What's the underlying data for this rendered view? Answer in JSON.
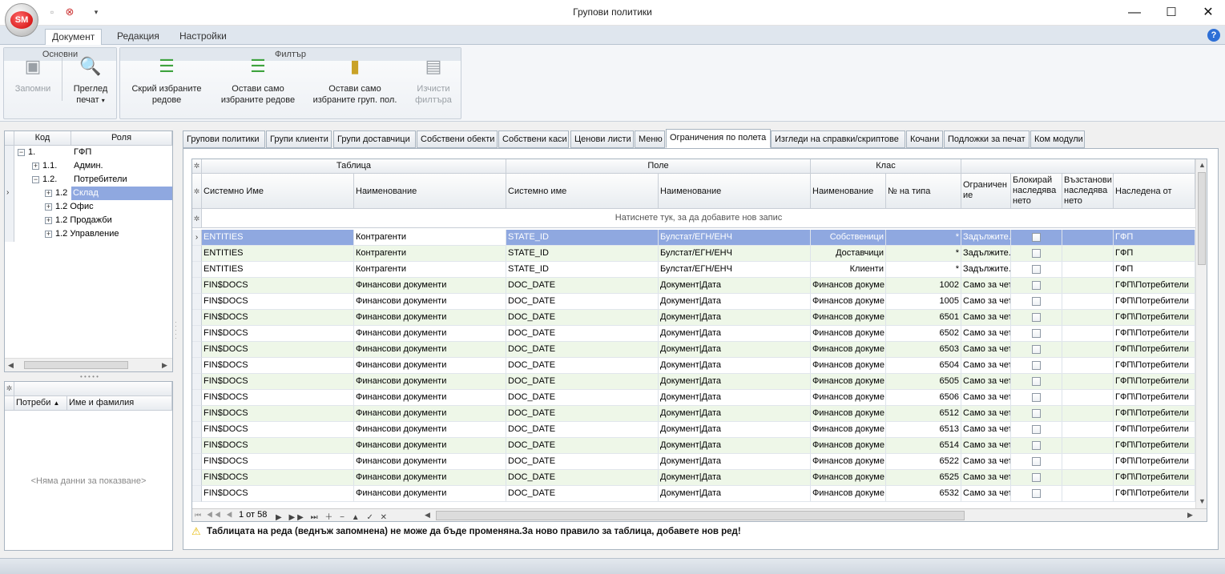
{
  "window": {
    "title": "Групови политики",
    "orb_label": "SM"
  },
  "ribbon": {
    "tabs": [
      "Документ",
      "Редакция",
      "Настройки"
    ],
    "groups": {
      "basic": {
        "label": "Основни",
        "save": "Запомни",
        "preview_l1": "Преглед",
        "preview_l2": "печат"
      },
      "filter": {
        "label": "Филтър",
        "hide_l1": "Скрий избраните",
        "hide_l2": "редове",
        "keep_l1": "Остави само",
        "keep_l2": "избраните редове",
        "keepgrp_l1": "Остави само",
        "keepgrp_l2": "избраните груп. пол.",
        "clear_l1": "Изчисти",
        "clear_l2": "филтъра"
      }
    }
  },
  "left_tree": {
    "headers": {
      "code": "Код",
      "role": "Роля"
    },
    "rows": [
      {
        "code": "1.",
        "role": "ГФП"
      },
      {
        "code": "1.1.",
        "role": "Админ."
      },
      {
        "code": "1.2.",
        "role": "Потребители"
      },
      {
        "code": "1.2",
        "role": "Склад"
      },
      {
        "code": "1.2",
        "role": "Офис"
      },
      {
        "code": "1.2",
        "role": "Продажби"
      },
      {
        "code": "1.2",
        "role": "Управление"
      }
    ]
  },
  "users_grid": {
    "headers": {
      "user": "Потреби",
      "name": "Име и фамилия"
    },
    "empty": "<Няма данни за показване>"
  },
  "tabs": [
    "Групови политики",
    "Групи клиенти",
    "Групи доставчици",
    "Собствени обекти",
    "Собствени каси",
    "Ценови листи",
    "Меню",
    "Ограничения по полета",
    "Изгледи на справки/скриптове",
    "Кочани",
    "Подложки за печат",
    "Ком модули"
  ],
  "main_grid": {
    "bands": {
      "table": "Таблица",
      "field": "Поле",
      "class": "Клас"
    },
    "columns": [
      "Системно Име",
      "Наименование",
      "Системно име",
      "Наименование",
      "Наименование",
      "№ на типа",
      "Ограничение",
      "Блокирай наследяването",
      "Възстанови наследяването",
      "Наследена от"
    ],
    "col_l1": {
      "restrict": "Ограничен",
      "block": "Блокирай",
      "restore": "Възстанови"
    },
    "col_l2": {
      "restrict": "ие",
      "block": "наследява",
      "restore": "наследява"
    },
    "col_l3": {
      "block": "нето",
      "restore": "нето"
    },
    "new_row": "Натиснете тук, за да добавите нов запис",
    "rows": [
      {
        "sys": "ENTITIES",
        "name": "Контрагенти",
        "fsys": "STATE_ID",
        "fname": "Булстат/ЕГН/ЕНЧ",
        "cls": "Собственици",
        "type": "*",
        "restr": "Задължите.",
        "inh": "ГФП"
      },
      {
        "sys": "ENTITIES",
        "name": "Контрагенти",
        "fsys": "STATE_ID",
        "fname": "Булстат/ЕГН/ЕНЧ",
        "cls": "Доставчици",
        "type": "*",
        "restr": "Задължите.",
        "inh": "ГФП"
      },
      {
        "sys": "ENTITIES",
        "name": "Контрагенти",
        "fsys": "STATE_ID",
        "fname": "Булстат/ЕГН/ЕНЧ",
        "cls": "Клиенти",
        "type": "*",
        "restr": "Задължите.",
        "inh": "ГФП"
      },
      {
        "sys": "FIN$DOCS",
        "name": "Финансови документи",
        "fsys": "DOC_DATE",
        "fname": "Документ|Дата",
        "cls": "Финансов докуме",
        "type": "1002",
        "restr": "Само за чет",
        "inh": "ГФП\\Потребители"
      },
      {
        "sys": "FIN$DOCS",
        "name": "Финансови документи",
        "fsys": "DOC_DATE",
        "fname": "Документ|Дата",
        "cls": "Финансов докуме",
        "type": "1005",
        "restr": "Само за чет",
        "inh": "ГФП\\Потребители"
      },
      {
        "sys": "FIN$DOCS",
        "name": "Финансови документи",
        "fsys": "DOC_DATE",
        "fname": "Документ|Дата",
        "cls": "Финансов докуме",
        "type": "6501",
        "restr": "Само за чет",
        "inh": "ГФП\\Потребители"
      },
      {
        "sys": "FIN$DOCS",
        "name": "Финансови документи",
        "fsys": "DOC_DATE",
        "fname": "Документ|Дата",
        "cls": "Финансов докуме",
        "type": "6502",
        "restr": "Само за чет",
        "inh": "ГФП\\Потребители"
      },
      {
        "sys": "FIN$DOCS",
        "name": "Финансови документи",
        "fsys": "DOC_DATE",
        "fname": "Документ|Дата",
        "cls": "Финансов докуме",
        "type": "6503",
        "restr": "Само за чет",
        "inh": "ГФП\\Потребители"
      },
      {
        "sys": "FIN$DOCS",
        "name": "Финансови документи",
        "fsys": "DOC_DATE",
        "fname": "Документ|Дата",
        "cls": "Финансов докуме",
        "type": "6504",
        "restr": "Само за чет",
        "inh": "ГФП\\Потребители"
      },
      {
        "sys": "FIN$DOCS",
        "name": "Финансови документи",
        "fsys": "DOC_DATE",
        "fname": "Документ|Дата",
        "cls": "Финансов докуме",
        "type": "6505",
        "restr": "Само за чет",
        "inh": "ГФП\\Потребители"
      },
      {
        "sys": "FIN$DOCS",
        "name": "Финансови документи",
        "fsys": "DOC_DATE",
        "fname": "Документ|Дата",
        "cls": "Финансов докуме",
        "type": "6506",
        "restr": "Само за чет",
        "inh": "ГФП\\Потребители"
      },
      {
        "sys": "FIN$DOCS",
        "name": "Финансови документи",
        "fsys": "DOC_DATE",
        "fname": "Документ|Дата",
        "cls": "Финансов докуме",
        "type": "6512",
        "restr": "Само за чет",
        "inh": "ГФП\\Потребители"
      },
      {
        "sys": "FIN$DOCS",
        "name": "Финансови документи",
        "fsys": "DOC_DATE",
        "fname": "Документ|Дата",
        "cls": "Финансов докуме",
        "type": "6513",
        "restr": "Само за чет",
        "inh": "ГФП\\Потребители"
      },
      {
        "sys": "FIN$DOCS",
        "name": "Финансови документи",
        "fsys": "DOC_DATE",
        "fname": "Документ|Дата",
        "cls": "Финансов докуме",
        "type": "6514",
        "restr": "Само за чет",
        "inh": "ГФП\\Потребители"
      },
      {
        "sys": "FIN$DOCS",
        "name": "Финансови документи",
        "fsys": "DOC_DATE",
        "fname": "Документ|Дата",
        "cls": "Финансов докуме",
        "type": "6522",
        "restr": "Само за чет",
        "inh": "ГФП\\Потребители"
      },
      {
        "sys": "FIN$DOCS",
        "name": "Финансови документи",
        "fsys": "DOC_DATE",
        "fname": "Документ|Дата",
        "cls": "Финансов докуме",
        "type": "6525",
        "restr": "Само за чет",
        "inh": "ГФП\\Потребители"
      },
      {
        "sys": "FIN$DOCS",
        "name": "Финансови документи",
        "fsys": "DOC_DATE",
        "fname": "Документ|Дата",
        "cls": "Финансов докуме",
        "type": "6532",
        "restr": "Само за чет",
        "inh": "ГФП\\Потребители"
      }
    ],
    "navigator": "1 от 58"
  },
  "warning": "Таблицата на реда (веднъж запомнена) не може да бъде променяна.За ново правило за таблица, добавете нов ред!",
  "colors": {
    "selected": "#8fa8e0",
    "alt_row": "#eef7e8",
    "accent": "#2d6fd6"
  }
}
